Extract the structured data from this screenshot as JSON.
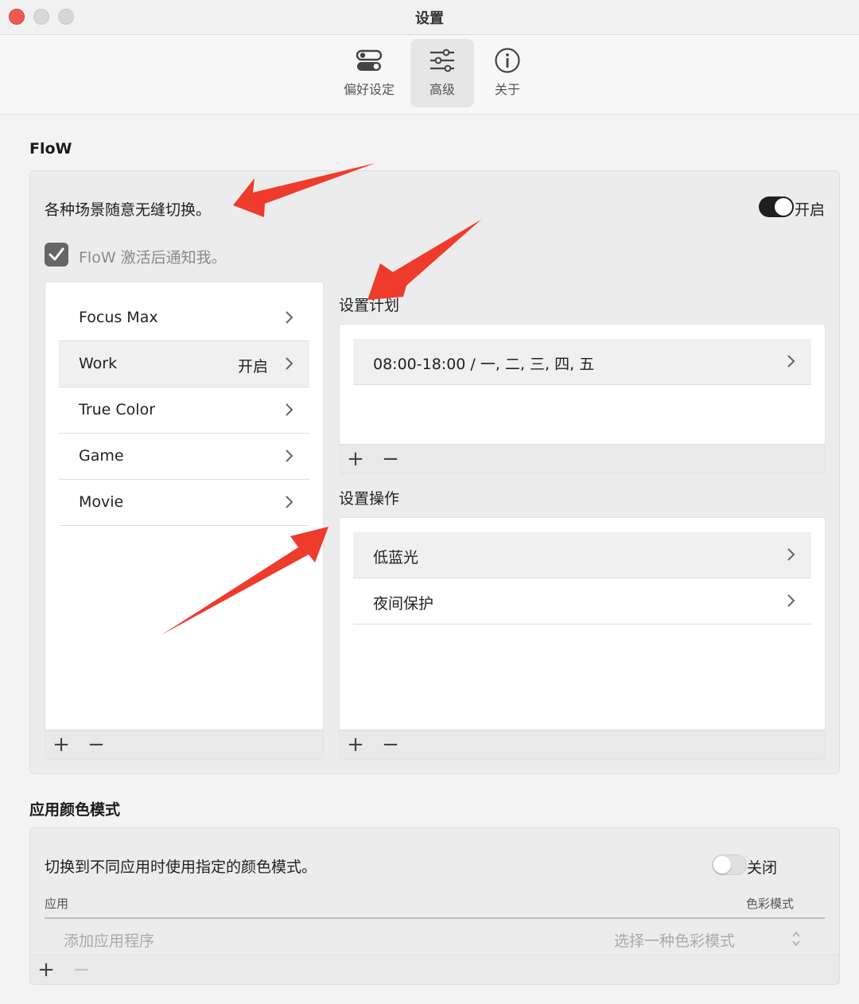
{
  "window": {
    "title": "设置"
  },
  "tabs": [
    {
      "label": "偏好设定",
      "icon": "toggles-icon"
    },
    {
      "label": "高级",
      "icon": "sliders-icon",
      "active": true
    },
    {
      "label": "关于",
      "icon": "info-icon"
    }
  ],
  "flow": {
    "section_title": "FloW",
    "description": "各种场景随意无缝切换。",
    "toggle_label": "开启",
    "toggle_on": true,
    "notify_label": "FloW 激活后通知我。",
    "notify_checked": true,
    "scenes": [
      {
        "name": "Focus Max",
        "status": ""
      },
      {
        "name": "Work",
        "status": "开启"
      },
      {
        "name": "True Color",
        "status": ""
      },
      {
        "name": "Game",
        "status": ""
      },
      {
        "name": "Movie",
        "status": ""
      }
    ],
    "schedule_title": "设置计划",
    "schedule": [
      {
        "text": "08:00-18:00  / 一, 二, 三, 四, 五"
      }
    ],
    "actions_title": "设置操作",
    "actions": [
      {
        "text": "低蓝光"
      },
      {
        "text": "夜间保护"
      }
    ],
    "add_symbol": "+",
    "remove_symbol": "−"
  },
  "color_mode": {
    "section_title": "应用颜色模式",
    "description": "切换到不同应用时使用指定的颜色模式。",
    "toggle_label": "关闭",
    "toggle_on": false,
    "col_app": "应用",
    "col_mode": "色彩模式",
    "add_app_placeholder": "添加应用程序",
    "select_mode_placeholder": "选择一种色彩模式",
    "add_symbol": "+",
    "remove_symbol": "−"
  },
  "colors": {
    "accent_arrow": "#ee3b2c",
    "toggle_on": "#1f1f1f",
    "close_button": "#ee5a52"
  }
}
